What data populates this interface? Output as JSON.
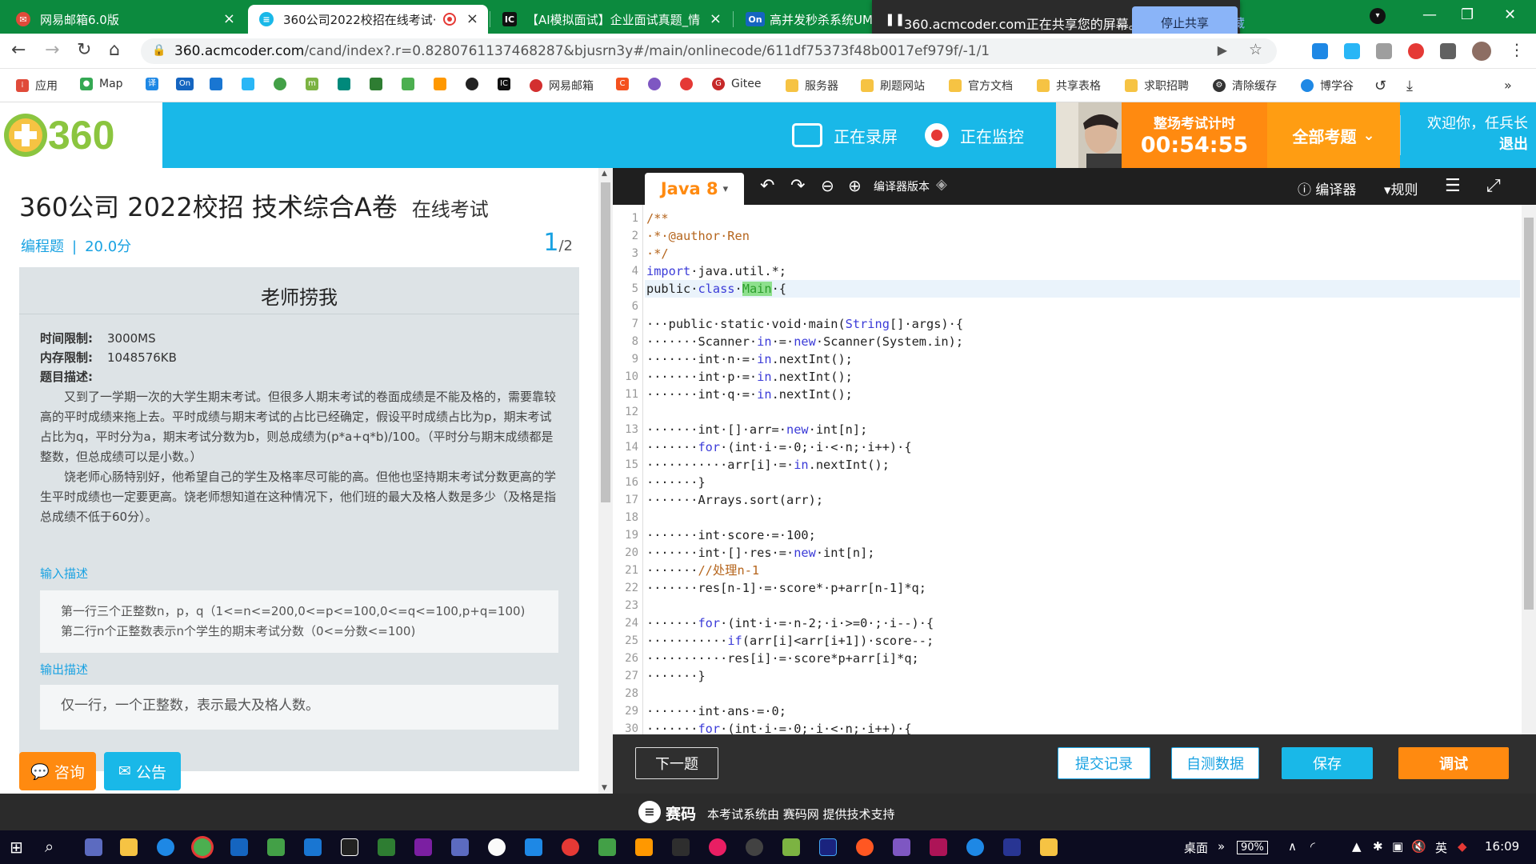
{
  "browser": {
    "tabs": [
      {
        "title": "网易邮箱6.0版",
        "icon": "mail-icon",
        "active": false
      },
      {
        "title": "360公司2022校招在线考试·",
        "icon": "acmcoder-icon",
        "active": true
      },
      {
        "title": "【AI模拟面试】企业面试真题_情",
        "icon": "nowcoder-icon",
        "active": false
      },
      {
        "title": "高并发秒杀系统UML分",
        "icon": "onenote-icon",
        "active": false
      }
    ],
    "share_bar": {
      "text": "360.acmcoder.com正在共享您的屏幕。",
      "stop_label": "停止共享",
      "hide_label": "隐藏"
    },
    "url_host": "360.acmcoder.com",
    "url_rest": "/cand/index?.r=0.8280761137468287&bjusrn3y#/main/onlinecode/611df75373f48b0017ef979f/-1/1",
    "bookmarks": [
      {
        "label": "应用",
        "color": "#e04b3a"
      },
      {
        "label": "Map",
        "color": "#34a853"
      },
      {
        "label": "",
        "color": "#1e88e5"
      },
      {
        "label": "",
        "color": "#1565c0"
      },
      {
        "label": "",
        "color": "#1976d2"
      },
      {
        "label": "",
        "color": "#29b6f6"
      },
      {
        "label": "",
        "color": "#43a047"
      },
      {
        "label": "",
        "color": "#7cb342"
      },
      {
        "label": "",
        "color": "#00897b"
      },
      {
        "label": "",
        "color": "#2e7d32"
      },
      {
        "label": "",
        "color": "#4caf50"
      },
      {
        "label": "",
        "color": "#ff9800"
      },
      {
        "label": "",
        "color": "#222222"
      },
      {
        "label": "",
        "color": "#111111"
      },
      {
        "label": "网易邮箱",
        "color": "#d32f2f"
      },
      {
        "label": "",
        "color": "#f4511e"
      },
      {
        "label": "",
        "color": "#7e57c2"
      },
      {
        "label": "",
        "color": "#e53935"
      },
      {
        "label": "Gitee",
        "color": "#c62828"
      },
      {
        "label": "服务器",
        "color": "#f6c343"
      },
      {
        "label": "刷题网站",
        "color": "#f6c343"
      },
      {
        "label": "官方文档",
        "color": "#f6c343"
      },
      {
        "label": "共享表格",
        "color": "#f6c343"
      },
      {
        "label": "求职招聘",
        "color": "#f6c343"
      },
      {
        "label": "清除缓存",
        "color": "#333333"
      },
      {
        "label": "博学谷",
        "color": "#1e88e5"
      }
    ]
  },
  "header": {
    "recording": "正在录屏",
    "monitoring": "正在监控",
    "timer_label": "整场考试计时",
    "timer_value": "00:54:55",
    "all_topics": "全部考题",
    "welcome": "欢迎你，任兵长",
    "logout": "退出"
  },
  "problem": {
    "exam_title": "360公司 2022校招 技术综合A卷",
    "exam_status": "在线考试",
    "type": "编程题",
    "score": "20.0分",
    "current": "1",
    "total": "/2",
    "name": "老师捞我",
    "time_limit_label": "时间限制:",
    "time_limit": "3000MS",
    "memory_limit_label": "内存限制:",
    "memory_limit": "1048576KB",
    "desc_label": "题目描述:",
    "desc_p1": "又到了一学期一次的大学生期末考试。但很多人期末考试的卷面成绩是不能及格的，需要靠较高的平时成绩来拖上去。平时成绩与期末考试的占比已经确定，假设平时成绩占比为p，期末考试占比为q，平时分为a，期末考试分数为b，则总成绩为(p*a+q*b)/100。（平时分与期末成绩都是整数，但总成绩可以是小数。）",
    "desc_p2": "饶老师心肠特别好，他希望自己的学生及格率尽可能的高。但他也坚持期末考试分数更高的学生平时成绩也一定要更高。饶老师想知道在这种情况下，他们班的最大及格人数是多少（及格是指总成绩不低于60分）。",
    "input_label": "输入描述",
    "input_line1": "第一行三个正整数n，p，q（1<=n<=200,0<=p<=100,0<=q<=100,p+q=100)",
    "input_line2": "第二行n个正整数表示n个学生的期末考试分数（0<=分数<=100)",
    "output_label": "输出描述",
    "output_text": "仅一行，一个正整数，表示最大及格人数。",
    "consult": "咨询",
    "notice": "公告"
  },
  "editor": {
    "language": "Java 8",
    "compiler_version": "编译器版本",
    "compiler": "编译器",
    "rules": "规则",
    "highlighted_line": 5,
    "code": [
      [
        [
          "cm",
          "/**"
        ]
      ],
      [
        [
          "cm",
          "·*·@author·Ren"
        ]
      ],
      [
        [
          "cm",
          "·*/"
        ]
      ],
      [
        [
          "kw",
          "import"
        ],
        [
          "",
          "·java.util.*;"
        ]
      ],
      [
        [
          "",
          "public·"
        ],
        [
          "kw",
          "class"
        ],
        [
          "",
          "·"
        ],
        [
          "nm",
          "Main"
        ],
        [
          "",
          "·{"
        ]
      ],
      [
        [
          "",
          ""
        ]
      ],
      [
        [
          "",
          "···public·static·void·main("
        ],
        [
          "ty",
          "String"
        ],
        [
          "",
          "[]·args)·{"
        ]
      ],
      [
        [
          "",
          "·······Scanner·"
        ],
        [
          "kw",
          "in"
        ],
        [
          "",
          "·=·"
        ],
        [
          "kw",
          "new"
        ],
        [
          "",
          "·Scanner(System.in);"
        ]
      ],
      [
        [
          "",
          "·······int·n·=·"
        ],
        [
          "kw",
          "in"
        ],
        [
          "",
          ".nextInt();"
        ]
      ],
      [
        [
          "",
          "·······int·p·=·"
        ],
        [
          "kw",
          "in"
        ],
        [
          "",
          ".nextInt();"
        ]
      ],
      [
        [
          "",
          "·······int·q·=·"
        ],
        [
          "kw",
          "in"
        ],
        [
          "",
          ".nextInt();"
        ]
      ],
      [
        [
          "",
          ""
        ]
      ],
      [
        [
          "",
          "·······int·[]·arr=·"
        ],
        [
          "kw",
          "new"
        ],
        [
          "",
          "·int[n];"
        ]
      ],
      [
        [
          "",
          "·······"
        ],
        [
          "kw",
          "for"
        ],
        [
          "",
          "·(int·i·=·0;·i·<·n;·i++)·{"
        ]
      ],
      [
        [
          "",
          "···········arr[i]·=·"
        ],
        [
          "kw",
          "in"
        ],
        [
          "",
          ".nextInt();"
        ]
      ],
      [
        [
          "",
          "·······}"
        ]
      ],
      [
        [
          "",
          "·······Arrays.sort(arr);"
        ]
      ],
      [
        [
          "",
          ""
        ]
      ],
      [
        [
          "",
          "·······int·score·=·100;"
        ]
      ],
      [
        [
          "",
          "·······int·[]·res·=·"
        ],
        [
          "kw",
          "new"
        ],
        [
          "",
          "·int[n];"
        ]
      ],
      [
        [
          "",
          "·······"
        ],
        [
          "cm",
          "//处理n-1"
        ]
      ],
      [
        [
          "",
          "·······res[n-1]·=·score*·p+arr[n-1]*q;"
        ]
      ],
      [
        [
          "",
          ""
        ]
      ],
      [
        [
          "",
          "·······"
        ],
        [
          "kw",
          "for"
        ],
        [
          "",
          "·(int·i·=·n-2;·i·>=0·;·i--)·{"
        ]
      ],
      [
        [
          "",
          "···········"
        ],
        [
          "kw",
          "if"
        ],
        [
          "",
          "(arr[i]<arr[i+1])·score--;"
        ]
      ],
      [
        [
          "",
          "···········res[i]·=·score*p+arr[i]*q;"
        ]
      ],
      [
        [
          "",
          "·······}"
        ]
      ],
      [
        [
          "",
          ""
        ]
      ],
      [
        [
          "",
          "·······int·ans·=·0;"
        ]
      ],
      [
        [
          "",
          "·······"
        ],
        [
          "kw",
          "for"
        ],
        [
          "",
          "·(int·i·=·0;·i·<·n;·i++)·{"
        ]
      ]
    ],
    "next_label": "下一题",
    "submit_log": "提交记录",
    "self_test": "自测数据",
    "save": "保存",
    "debug": "调试"
  },
  "footer": {
    "brand": "赛码",
    "support": "本考试系统由 赛码网 提供技术支持"
  },
  "taskbar": {
    "desktop": "桌面",
    "battery": "90%",
    "ime": "英",
    "time": "16:09"
  },
  "colors": {
    "chrome_green": "#0c8a3e",
    "brand_blue": "#19b8e8",
    "accent_orange": "#ff8a10",
    "link_blue": "#19a2e2"
  }
}
